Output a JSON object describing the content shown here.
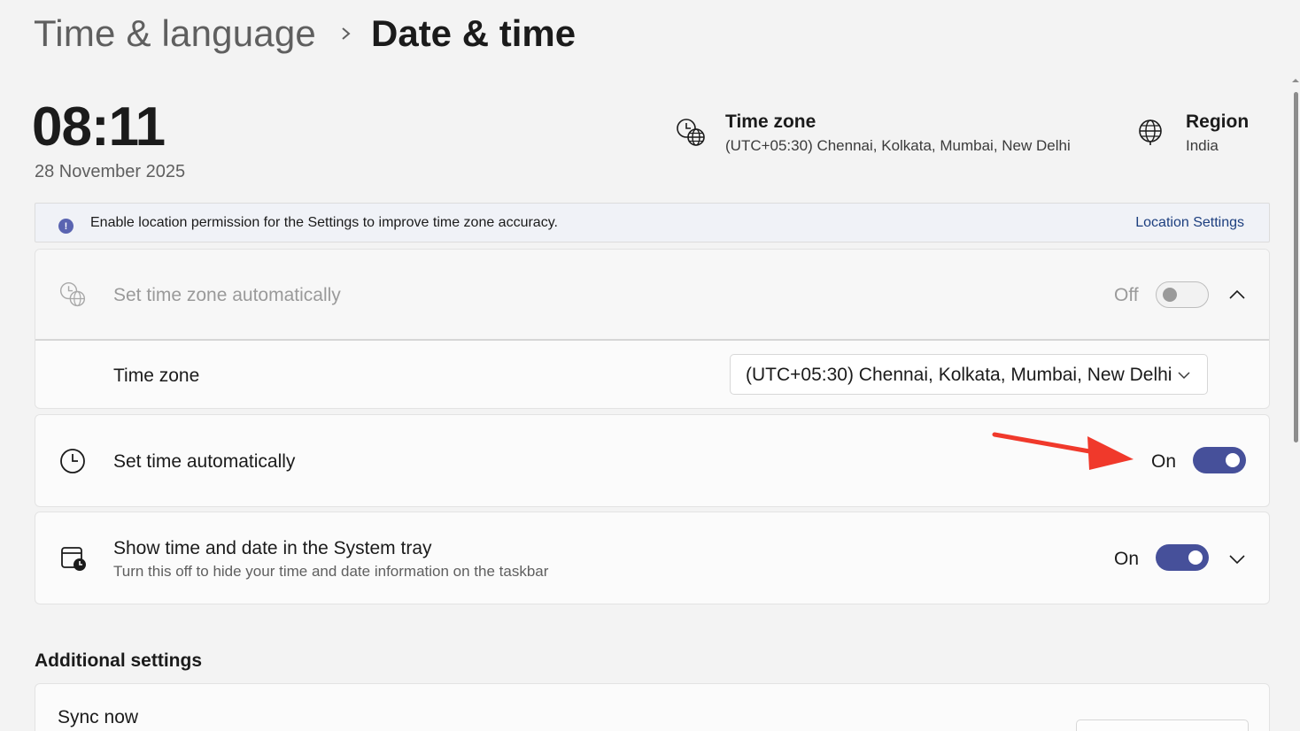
{
  "breadcrumb": {
    "parent": "Time & language",
    "current": "Date & time",
    "separator_icon": "chevron-right-icon"
  },
  "clock": {
    "time": "08:11",
    "date": "28 November 2025"
  },
  "header_info": {
    "timezone": {
      "title": "Time zone",
      "value": "(UTC+05:30) Chennai, Kolkata, Mumbai, New Delhi",
      "icon": "timezone-globe-clock-icon"
    },
    "region": {
      "title": "Region",
      "value": "India",
      "icon": "globe-icon"
    }
  },
  "info_bar": {
    "text": "Enable location permission for the Settings to improve time zone accuracy.",
    "link": "Location Settings",
    "icon": "info-icon"
  },
  "settings": {
    "auto_timezone": {
      "label": "Set time zone automatically",
      "state": "Off",
      "enabled": false,
      "expanded": true
    },
    "timezone_select": {
      "label": "Time zone",
      "selected": "(UTC+05:30) Chennai, Kolkata, Mumbai, New Delhi"
    },
    "auto_time": {
      "label": "Set time automatically",
      "state": "On",
      "enabled": true
    },
    "systray": {
      "label": "Show time and date in the System tray",
      "description": "Turn this off to hide your time and date information on the taskbar",
      "state": "On",
      "enabled": true,
      "expanded": false
    }
  },
  "additional": {
    "title": "Additional settings",
    "sync_label": "Sync now"
  },
  "colors": {
    "accent": "#46509a",
    "annotation_arrow": "#f0392b",
    "link": "#1d3f7f",
    "background": "#f3f3f3"
  }
}
